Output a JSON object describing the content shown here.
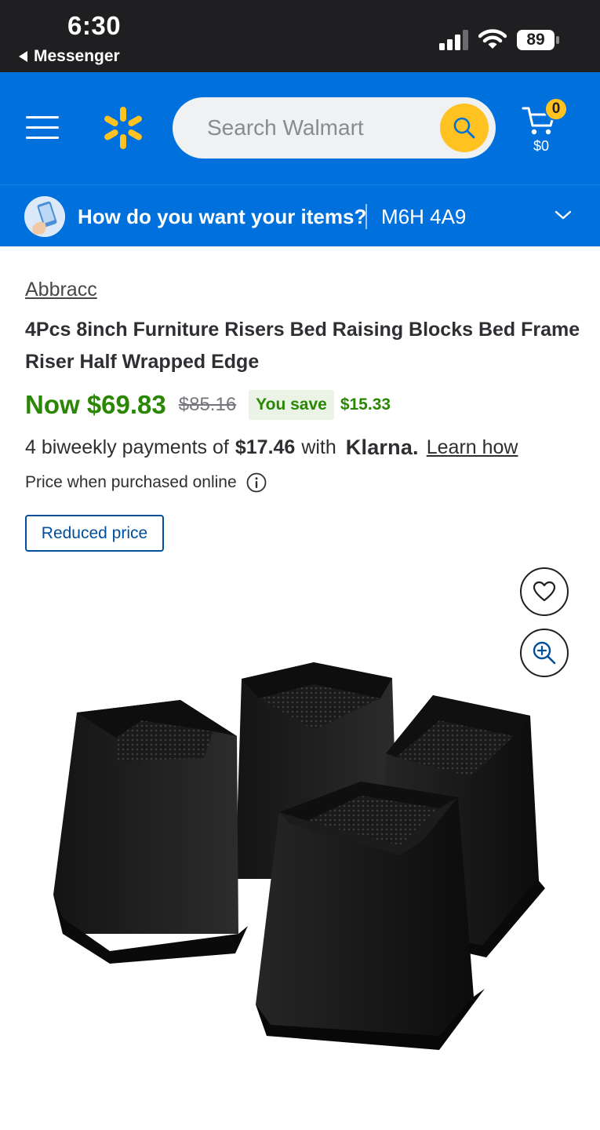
{
  "status_bar": {
    "time": "6:30",
    "back_app": "Messenger",
    "battery": "89"
  },
  "header": {
    "search_placeholder": "Search Walmart",
    "cart_count": "0",
    "cart_total": "$0",
    "brand_color": "#0071dc",
    "accent_color": "#ffc220"
  },
  "fulfillment": {
    "prompt": "How do you want your items?",
    "postal_code": "M6H 4A9"
  },
  "product": {
    "brand": "Abbracc",
    "title": "4Pcs 8inch Furniture Risers Bed Raising Blocks Bed Frame Riser Half Wrapped Edge",
    "price_now": "Now $69.83",
    "price_was": "$85.16",
    "save_label": "You save",
    "save_amount": "$15.33",
    "installment_prefix": "4 biweekly payments of",
    "installment_amount": "$17.46",
    "installment_with": "with",
    "installment_provider": "Klarna.",
    "learn_how": "Learn how",
    "price_note": "Price when purchased online",
    "tag": "Reduced price",
    "price_color": "#2a8703"
  },
  "icons": {
    "menu": "hamburger-menu-icon",
    "logo": "walmart-spark-icon",
    "search": "search-icon",
    "cart": "cart-icon",
    "info": "info-icon",
    "favorite": "heart-icon",
    "zoom": "zoom-in-icon",
    "dropdown": "chevron-down-icon"
  }
}
